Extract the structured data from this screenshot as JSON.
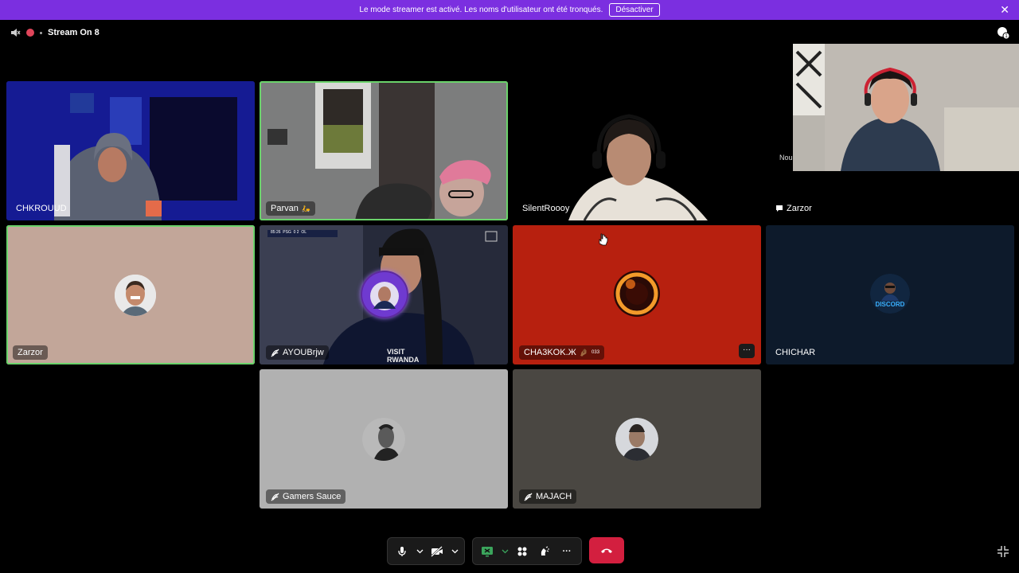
{
  "banner": {
    "message": "Le mode streamer est activé. Les noms d'utilisateur ont été tronqués.",
    "button_label": "Désactiver",
    "close_glyph": "✕"
  },
  "header": {
    "stream_title": "Stream On 8",
    "notification_count": "1"
  },
  "pip": {
    "label": "Nou"
  },
  "tiles": [
    {
      "name": "CHKROUUD"
    },
    {
      "name": "Parvan",
      "suffix": "🛵"
    },
    {
      "name": "SilentRoooy"
    },
    {
      "name": "Zarzor",
      "icon": "chat-bubble-icon"
    },
    {
      "name": "Zarzor"
    },
    {
      "name": "AYOUBrjw",
      "icon": "stream-off-icon",
      "scoreboard": "85:26  PSG  0 2  OL"
    },
    {
      "name": "CHA3KOK.Ж",
      "suffix": "🤌🏾",
      "superscript": "033"
    },
    {
      "name": "CHICHAR",
      "avatar_text": "DISCORD"
    },
    {
      "name": "Gamers Sauce",
      "icon": "stream-off-icon"
    },
    {
      "name": "MAJACH",
      "icon": "stream-off-icon"
    }
  ],
  "controls": {
    "more_label": "···"
  },
  "colors": {
    "banner": "#7b2fe0",
    "speaking": "#6bd36b",
    "end_call": "#d31f3f"
  }
}
